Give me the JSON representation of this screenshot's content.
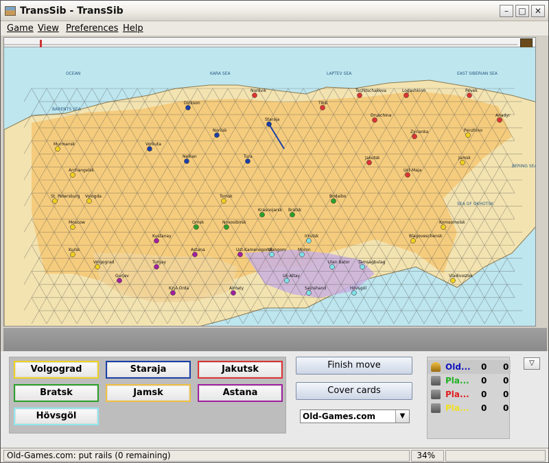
{
  "window": {
    "title": "TransSib - TransSib"
  },
  "menu": [
    "Game",
    "View",
    "Preferences",
    "Help"
  ],
  "map": {
    "sea_labels": [
      "BARENTS SEA",
      "OCEAN",
      "KARA SEA",
      "LAPTEV SEA",
      "EAST SIBERIAN SEA",
      "BERING SEA",
      "SEA OF OKHOTSK"
    ],
    "cities": [
      {
        "name": "Nordvik",
        "color": "#d33"
      },
      {
        "name": "Tschitschakova",
        "color": "#d33"
      },
      {
        "name": "Logashkino",
        "color": "#d33"
      },
      {
        "name": "Pevek",
        "color": "#d33"
      },
      {
        "name": "Dickson",
        "color": "#1a3fa8"
      },
      {
        "name": "Staraja",
        "color": "#1a3fa8"
      },
      {
        "name": "Tiksi",
        "color": "#d33"
      },
      {
        "name": "Druschina",
        "color": "#d33"
      },
      {
        "name": "Anadyr",
        "color": "#d33"
      },
      {
        "name": "Noriisk",
        "color": "#1a3fa8"
      },
      {
        "name": "Zyrianka",
        "color": "#d33"
      },
      {
        "name": "Penzhino",
        "color": "#f0d020"
      },
      {
        "name": "Murmansk",
        "color": "#f0d020"
      },
      {
        "name": "Vorkuta",
        "color": "#1a3fa8"
      },
      {
        "name": "Nelkan",
        "color": "#1a3fa8"
      },
      {
        "name": "Tura",
        "color": "#1a3fa8"
      },
      {
        "name": "Jakutsk",
        "color": "#d33"
      },
      {
        "name": "Jamsk",
        "color": "#f0d020"
      },
      {
        "name": "Archangelsk",
        "color": "#f0d020"
      },
      {
        "name": "Ust-Maja",
        "color": "#d33"
      },
      {
        "name": "St. Petersburg",
        "color": "#f0d020"
      },
      {
        "name": "Vologda",
        "color": "#f0d020"
      },
      {
        "name": "Tomsk",
        "color": "#f0d020"
      },
      {
        "name": "Bodaibo",
        "color": "#2aa02a"
      },
      {
        "name": "Krasnojarsk",
        "color": "#2aa02a"
      },
      {
        "name": "Bratsk",
        "color": "#2aa02a"
      },
      {
        "name": "Moscow",
        "color": "#f0d020"
      },
      {
        "name": "Omsk",
        "color": "#2aa02a"
      },
      {
        "name": "Novosibirsk",
        "color": "#2aa02a"
      },
      {
        "name": "Komsomolsk",
        "color": "#f0d020"
      },
      {
        "name": "Kustanay",
        "color": "#a020a0"
      },
      {
        "name": "Irkutsk",
        "color": "#7fe0e8"
      },
      {
        "name": "Blagoveschensk",
        "color": "#f0d020"
      },
      {
        "name": "Kursk",
        "color": "#f0d020"
      },
      {
        "name": "Astana",
        "color": "#a020a0"
      },
      {
        "name": "Ust-Kamenogorsk",
        "color": "#a020a0"
      },
      {
        "name": "Ulangom",
        "color": "#7fe0e8"
      },
      {
        "name": "Moron",
        "color": "#7fe0e8"
      },
      {
        "name": "Volgograd",
        "color": "#f0d020"
      },
      {
        "name": "Turgay",
        "color": "#a020a0"
      },
      {
        "name": "Ulan Bator",
        "color": "#7fe0e8"
      },
      {
        "name": "Tamsagbulag",
        "color": "#7fe0e8"
      },
      {
        "name": "Gurjev",
        "color": "#a020a0"
      },
      {
        "name": "Ulj-Altay",
        "color": "#7fe0e8"
      },
      {
        "name": "Vladivostok",
        "color": "#f0d020"
      },
      {
        "name": "Kzyl-Orda",
        "color": "#a020a0"
      },
      {
        "name": "Almaty",
        "color": "#a020a0"
      },
      {
        "name": "Sajnshand",
        "color": "#7fe0e8"
      },
      {
        "name": "Hövsgöl",
        "color": "#7fe0e8"
      }
    ]
  },
  "cards": [
    {
      "label": "Volgograd",
      "color": "#f0d020"
    },
    {
      "label": "Staraja",
      "color": "#1a3fa8"
    },
    {
      "label": "Jakutsk",
      "color": "#d33"
    },
    {
      "label": "Bratsk",
      "color": "#2aa02a"
    },
    {
      "label": "Jamsk",
      "color": "#f0c040"
    },
    {
      "label": "Astana",
      "color": "#a020a0"
    },
    {
      "label": "Hövsgöl",
      "color": "#8fe6ee"
    }
  ],
  "buttons": {
    "finish": "Finish move",
    "cover": "Cover cards"
  },
  "player_select": "Old-Games.com",
  "scores": [
    {
      "name": "Old...",
      "color": "#1010c0",
      "a": "0",
      "b": "0",
      "icon": "pawn-icon"
    },
    {
      "name": "Pla...",
      "color": "#20b020",
      "a": "0",
      "b": "0",
      "icon": "robot-icon"
    },
    {
      "name": "Pla...",
      "color": "#e02020",
      "a": "0",
      "b": "0",
      "icon": "robot-icon"
    },
    {
      "name": "Pla...",
      "color": "#f0e020",
      "a": "0",
      "b": "0",
      "icon": "robot-icon"
    }
  ],
  "status": {
    "message": "Old-Games.com: put rails (0 remaining)",
    "zoom": "34%"
  }
}
